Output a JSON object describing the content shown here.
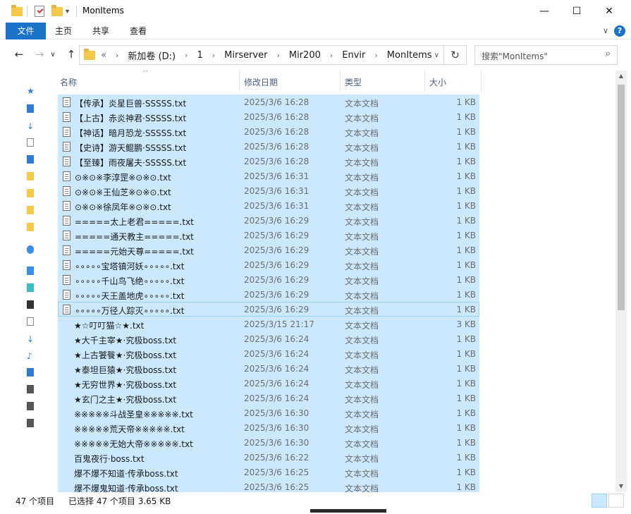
{
  "window": {
    "title": "MonItems",
    "minimize": "—",
    "maximize": "☐",
    "close": "✕"
  },
  "ribbon": {
    "tabs": [
      "文件",
      "主页",
      "共享",
      "查看"
    ],
    "help": "?",
    "expand": "∨"
  },
  "address": {
    "back": "←",
    "forward": "→",
    "recent": "∨",
    "up": "↑",
    "prefix": "«",
    "crumbs": [
      "新加卷 (D:)",
      "1",
      "Mirserver",
      "Mir200",
      "Envir",
      "MonItems"
    ],
    "dropdown": "∨",
    "refresh": "↻"
  },
  "search": {
    "placeholder": "搜索\"MonItems\"",
    "icon": "search-icon"
  },
  "columns": {
    "name": "名称",
    "date": "修改日期",
    "type": "类型",
    "size": "大小",
    "sort_caret": "^"
  },
  "files": [
    {
      "name": "【传承】炎星巨兽·SSSSS.txt",
      "date": "2025/3/6 16:28",
      "type": "文本文档",
      "size": "1 KB"
    },
    {
      "name": "【上古】赤炎神君·SSSSS.txt",
      "date": "2025/3/6 16:28",
      "type": "文本文档",
      "size": "1 KB"
    },
    {
      "name": "【神话】暗月恐龙·SSSSS.txt",
      "date": "2025/3/6 16:28",
      "type": "文本文档",
      "size": "1 KB"
    },
    {
      "name": "【史诗】游天鲲鹏·SSSSS.txt",
      "date": "2025/3/6 16:28",
      "type": "文本文档",
      "size": "1 KB"
    },
    {
      "name": "【至臻】雨夜屠夫·SSSSS.txt",
      "date": "2025/3/6 16:28",
      "type": "文本文档",
      "size": "1 KB"
    },
    {
      "name": "⊙※⊙※李淳罡※⊙※⊙.txt",
      "date": "2025/3/6 16:31",
      "type": "文本文档",
      "size": "1 KB"
    },
    {
      "name": "⊙※⊙※王仙芝※⊙※⊙.txt",
      "date": "2025/3/6 16:31",
      "type": "文本文档",
      "size": "1 KB"
    },
    {
      "name": "⊙※⊙※徐凤年※⊙※⊙.txt",
      "date": "2025/3/6 16:31",
      "type": "文本文档",
      "size": "1 KB"
    },
    {
      "name": "=====太上老君=====.txt",
      "date": "2025/3/6 16:29",
      "type": "文本文档",
      "size": "1 KB"
    },
    {
      "name": "=====通天教主=====.txt",
      "date": "2025/3/6 16:29",
      "type": "文本文档",
      "size": "1 KB"
    },
    {
      "name": "=====元始天尊=====.txt",
      "date": "2025/3/6 16:29",
      "type": "文本文档",
      "size": "1 KB"
    },
    {
      "name": "∘∘∘∘∘宝塔镇河妖∘∘∘∘∘.txt",
      "date": "2025/3/6 16:29",
      "type": "文本文档",
      "size": "1 KB"
    },
    {
      "name": "∘∘∘∘∘千山鸟飞绝∘∘∘∘∘.txt",
      "date": "2025/3/6 16:29",
      "type": "文本文档",
      "size": "1 KB"
    },
    {
      "name": "∘∘∘∘∘天王盖地虎∘∘∘∘∘.txt",
      "date": "2025/3/6 16:29",
      "type": "文本文档",
      "size": "1 KB"
    },
    {
      "name": "∘∘∘∘∘万径人踪灭∘∘∘∘∘.txt",
      "date": "2025/3/6 16:29",
      "type": "文本文档",
      "size": "1 KB"
    },
    {
      "name": "★☆叮叮猫☆★.txt",
      "date": "2025/3/15 21:17",
      "type": "文本文档",
      "size": "3 KB"
    },
    {
      "name": "★大千主宰★·究极boss.txt",
      "date": "2025/3/6 16:24",
      "type": "文本文档",
      "size": "1 KB"
    },
    {
      "name": "★上古饕餮★·究极boss.txt",
      "date": "2025/3/6 16:24",
      "type": "文本文档",
      "size": "1 KB"
    },
    {
      "name": "★泰坦巨猿★·究极boss.txt",
      "date": "2025/3/6 16:24",
      "type": "文本文档",
      "size": "1 KB"
    },
    {
      "name": "★无穷世界★·究极boss.txt",
      "date": "2025/3/6 16:24",
      "type": "文本文档",
      "size": "1 KB"
    },
    {
      "name": "★玄门之主★·究极boss.txt",
      "date": "2025/3/6 16:24",
      "type": "文本文档",
      "size": "1 KB"
    },
    {
      "name": "※※※※※斗战圣皇※※※※※.txt",
      "date": "2025/3/6 16:30",
      "type": "文本文档",
      "size": "1 KB"
    },
    {
      "name": "※※※※※荒天帝※※※※※.txt",
      "date": "2025/3/6 16:30",
      "type": "文本文档",
      "size": "1 KB"
    },
    {
      "name": "※※※※※无始大帝※※※※※.txt",
      "date": "2025/3/6 16:30",
      "type": "文本文档",
      "size": "1 KB"
    },
    {
      "name": "百鬼夜行·boss.txt",
      "date": "2025/3/6 16:22",
      "type": "文本文档",
      "size": "1 KB"
    },
    {
      "name": "爆不爆不知道·传承boss.txt",
      "date": "2025/3/6 16:25",
      "type": "文本文档",
      "size": "1 KB"
    },
    {
      "name": "爆不爆鬼知道·传承boss.txt",
      "date": "2025/3/6 16:25",
      "type": "文本文档",
      "size": "1 KB"
    }
  ],
  "status": {
    "item_count": "47 个项目",
    "selected": "已选择 47 个项目  3.65 KB"
  }
}
